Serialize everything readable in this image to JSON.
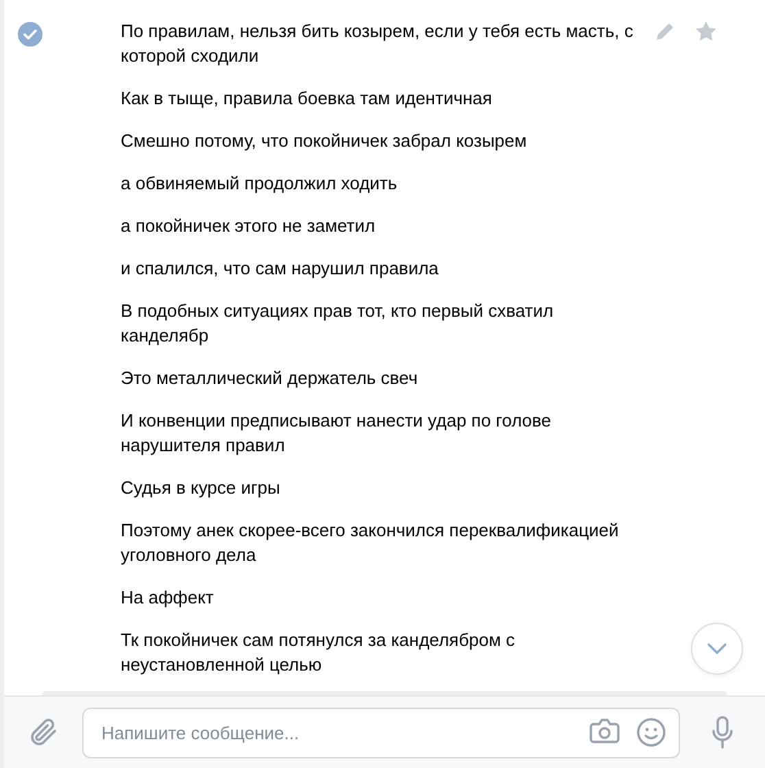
{
  "messages": [
    {
      "text": "По правилам, нельзя бить козырем, если у тебя есть масть, с которой сходили",
      "selected": true
    },
    {
      "text": "Как в тыще, правила боевка там идентичная",
      "selected": false
    },
    {
      "text": "Смешно потому, что покойничек забрал козырем",
      "selected": false
    },
    {
      "text": "а обвиняемый продолжил ходить",
      "selected": false
    },
    {
      "text": "а покойничек этого не заметил",
      "selected": false
    },
    {
      "text": "и спалился, что сам нарушил правила",
      "selected": false
    },
    {
      "text": "В подобных ситуациях прав тот, кто первый схватил канделябр",
      "selected": false
    },
    {
      "text": "Это металлический держатель свеч",
      "selected": false
    },
    {
      "text": "И конвенции предписывают нанести удар по голове нарушителя правил",
      "selected": false
    },
    {
      "text": "Судья в курсе игры",
      "selected": false
    },
    {
      "text": "Поэтому анек скорее-всего закончился переквалификацией уголовного дела",
      "selected": false
    },
    {
      "text": "На аффект",
      "selected": false
    },
    {
      "text": "Тк покойничек сам потянулся за канделябром с неустановленной целью",
      "selected": false
    }
  ],
  "composer": {
    "placeholder": "Напишите сообщение..."
  }
}
